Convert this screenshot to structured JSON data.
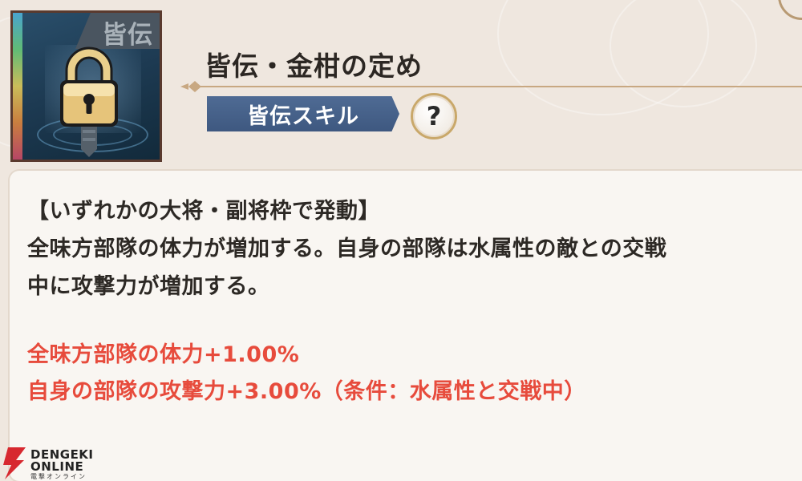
{
  "skill": {
    "icon_badge": "皆伝",
    "icon_name": "lock-icon",
    "title": "皆伝・金柑の定め",
    "type_label": "皆伝スキル",
    "help_label": "?"
  },
  "description": {
    "condition": "【いずれかの大将・副将枠で発動】",
    "body_lines": [
      "全味方部隊の体力が増加する。自身の部隊は水属性の敵との交戦",
      "中に攻撃力が増加する。"
    ],
    "effect_lines": [
      "全味方部隊の体力+1.00%",
      "自身の部隊の攻撃力+3.00%（条件：水属性と交戦中）"
    ]
  },
  "watermark": {
    "line1": "DENGEKI",
    "line2": "ONLINE",
    "line3": "電撃オンライン"
  },
  "colors": {
    "background": "#efe7df",
    "panel": "#f9f6f2",
    "badge_blue": "#46618a",
    "effect_red": "#e74b3c",
    "text_dark": "#2d2925"
  }
}
